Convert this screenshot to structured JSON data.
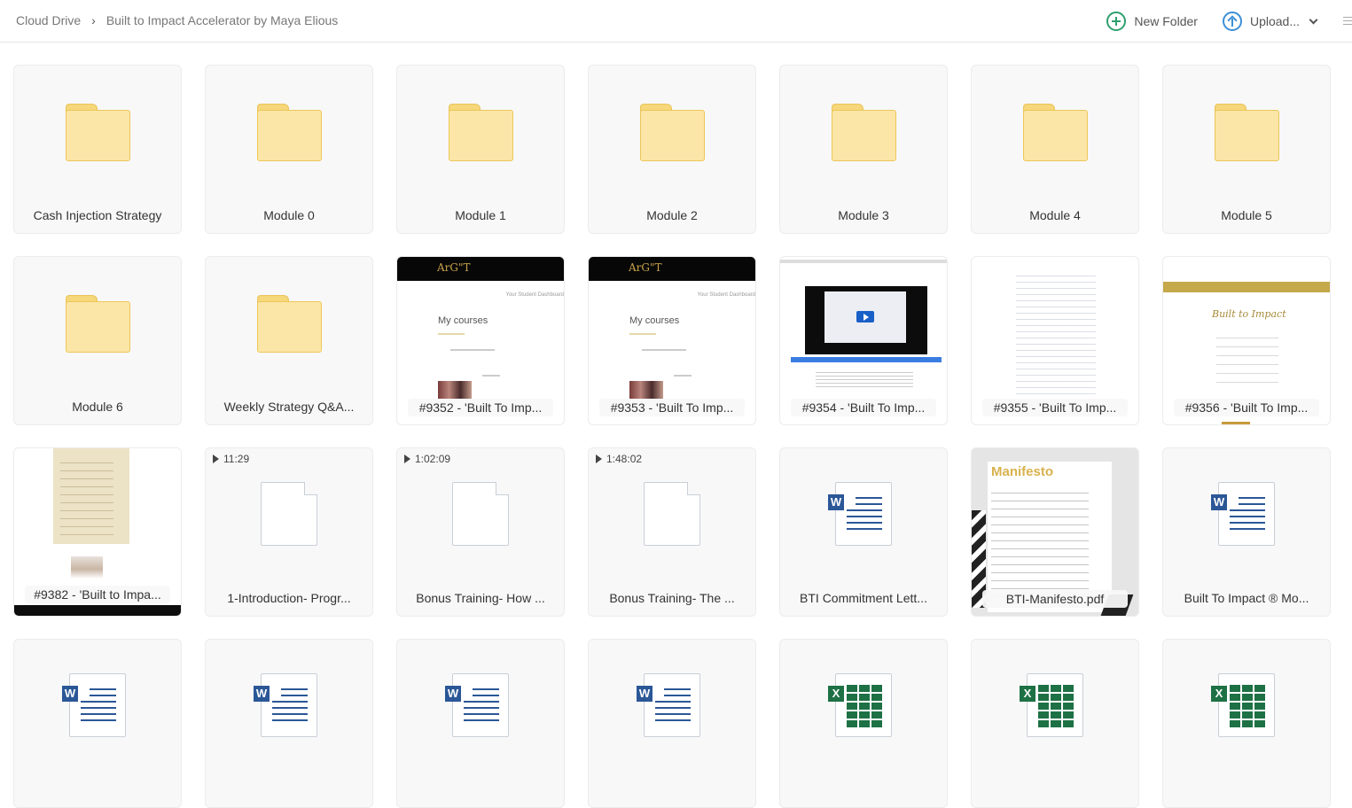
{
  "breadcrumb": {
    "root": "Cloud Drive",
    "current": "Built to Impact Accelerator by Maya Elious"
  },
  "toolbar": {
    "new_folder": "New Folder",
    "upload": "Upload..."
  },
  "items": [
    {
      "label": "Cash Injection Strategy",
      "kind": "folder"
    },
    {
      "label": "Module 0",
      "kind": "folder"
    },
    {
      "label": "Module 1",
      "kind": "folder"
    },
    {
      "label": "Module 2",
      "kind": "folder"
    },
    {
      "label": "Module 3",
      "kind": "folder"
    },
    {
      "label": "Module 4",
      "kind": "folder"
    },
    {
      "label": "Module 5",
      "kind": "folder"
    },
    {
      "label": "Module 6",
      "kind": "folder"
    },
    {
      "label": "Weekly Strategy Q&A...",
      "kind": "folder"
    },
    {
      "label": "#9352 - 'Built To Imp...",
      "kind": "image"
    },
    {
      "label": "#9353 - 'Built To Imp...",
      "kind": "image"
    },
    {
      "label": "#9354 - 'Built To Imp...",
      "kind": "image"
    },
    {
      "label": "#9355 - 'Built To Imp...",
      "kind": "image"
    },
    {
      "label": "#9356 - 'Built To Imp...",
      "kind": "image"
    },
    {
      "label": "#9382 - 'Built to Impa...",
      "kind": "image"
    },
    {
      "label": "1-Introduction- Progr...",
      "kind": "video",
      "duration": "11:29"
    },
    {
      "label": "Bonus Training- How ...",
      "kind": "video",
      "duration": "1:02:09"
    },
    {
      "label": "Bonus Training- The ...",
      "kind": "video",
      "duration": "1:48:02"
    },
    {
      "label": "BTI Commitment Lett...",
      "kind": "word"
    },
    {
      "label": "BTI-Manifesto.pdf",
      "kind": "pdf"
    },
    {
      "label": "Built To Impact ® Mo...",
      "kind": "word"
    },
    {
      "label": "",
      "kind": "word"
    },
    {
      "label": "",
      "kind": "word"
    },
    {
      "label": "",
      "kind": "word"
    },
    {
      "label": "",
      "kind": "word"
    },
    {
      "label": "",
      "kind": "excel"
    },
    {
      "label": "",
      "kind": "excel"
    },
    {
      "label": "",
      "kind": "excel"
    }
  ],
  "thumbnail_text": {
    "my_courses": "My courses",
    "student_dashboard": "Your Student Dashboard",
    "manifesto": "Manifesto"
  },
  "colors": {
    "folder": "#fbe6a7",
    "word": "#2b5797",
    "excel": "#1e7145",
    "new_folder_icon": "#2f9e6e",
    "upload_icon": "#3b8fd6"
  }
}
